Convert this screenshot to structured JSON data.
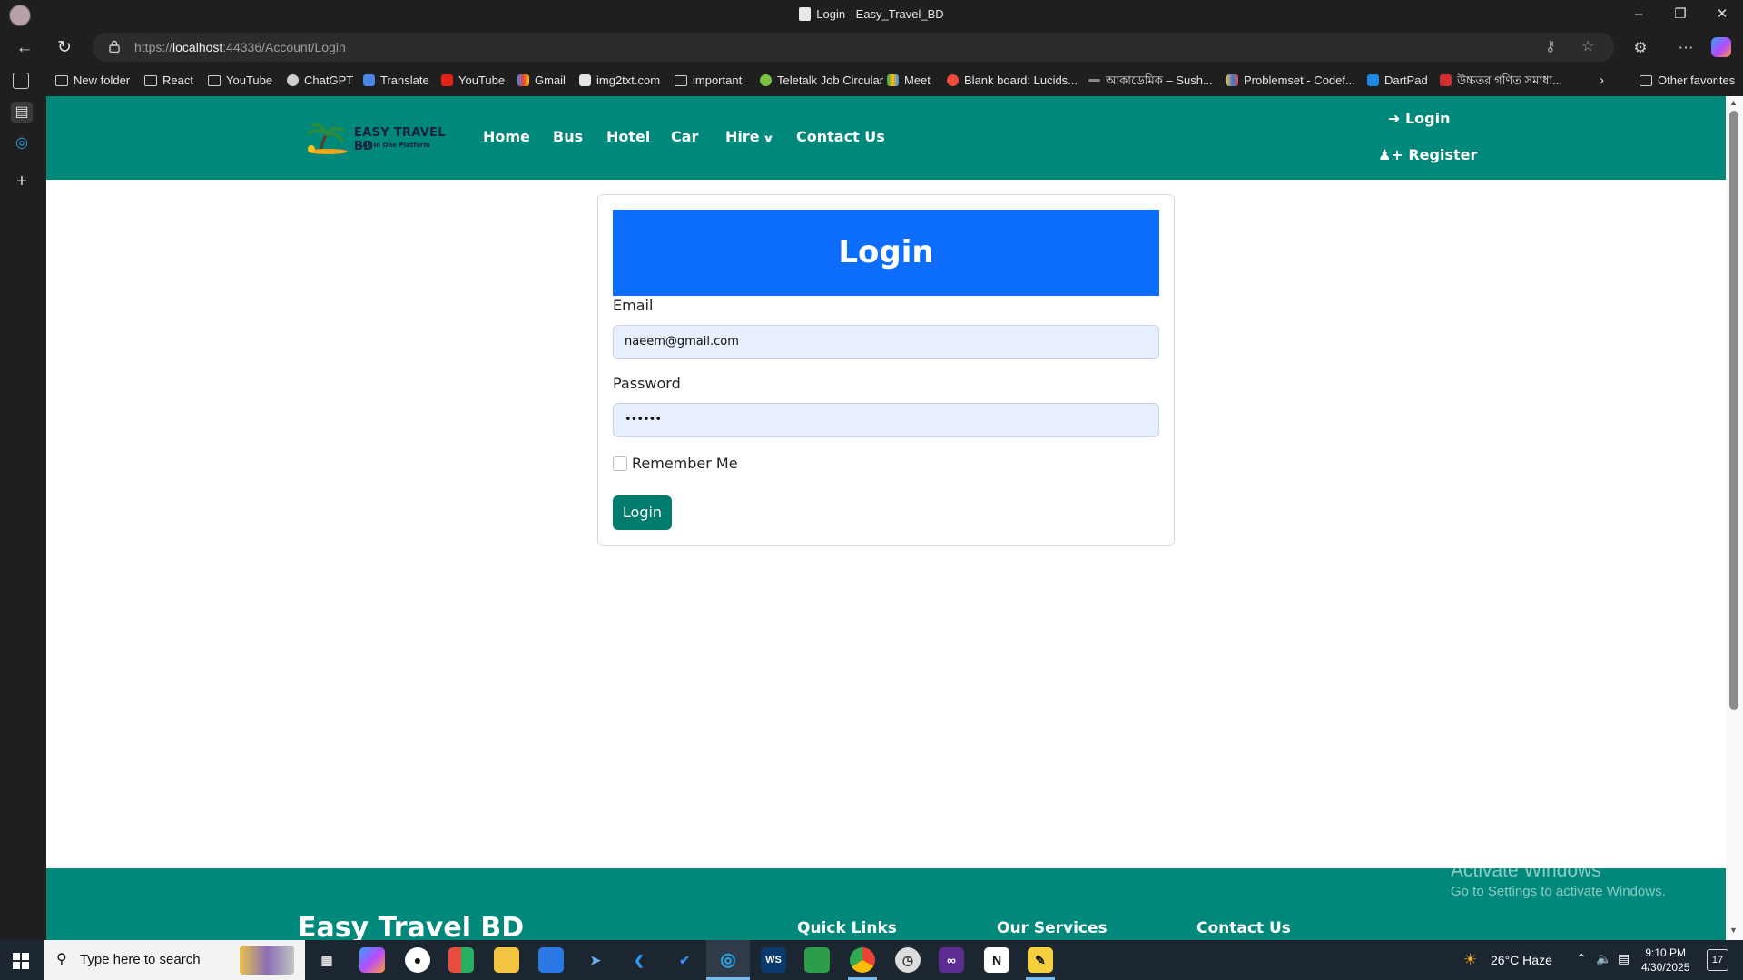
{
  "browser": {
    "window_title": "Login - Easy_Travel_BD",
    "url_scheme": "https://",
    "url_host": "localhost",
    "url_rest": ":44336/Account/Login",
    "bookmarks": [
      {
        "label": "New folder",
        "icon": "folder-icon"
      },
      {
        "label": "React",
        "icon": "folder-icon"
      },
      {
        "label": "YouTube",
        "icon": "folder-icon"
      },
      {
        "label": "ChatGPT",
        "icon": "chatgpt-icon"
      },
      {
        "label": "Translate",
        "icon": "translate-icon"
      },
      {
        "label": "YouTube",
        "icon": "youtube-icon"
      },
      {
        "label": "Gmail",
        "icon": "gmail-icon"
      },
      {
        "label": "img2txt.com",
        "icon": "page-icon"
      },
      {
        "label": "important",
        "icon": "folder-icon"
      },
      {
        "label": "Teletalk Job Circular",
        "icon": "teletalk-icon"
      },
      {
        "label": "Meet",
        "icon": "meet-icon"
      },
      {
        "label": "Blank board: Lucids...",
        "icon": "lucid-icon"
      },
      {
        "label": "আকাডেমিক – Sush...",
        "icon": "page-icon"
      },
      {
        "label": "Problemset - Codef...",
        "icon": "codeforces-icon"
      },
      {
        "label": "DartPad",
        "icon": "dart-icon"
      },
      {
        "label": "উচ্চতর গণিত সমাধা...",
        "icon": "book-icon"
      }
    ],
    "other_favorites": "Other favorites"
  },
  "site": {
    "logo_title": "EASY TRAVEL BD",
    "logo_tagline": "All in One Platform",
    "nav": [
      "Home",
      "Bus",
      "Hotel",
      "Car",
      "Hire",
      "Contact Us"
    ],
    "auth": {
      "login": "Login",
      "register": "Register"
    }
  },
  "form": {
    "heading": "Login",
    "email_label": "Email",
    "email_value": "naeem@gmail.com",
    "password_label": "Password",
    "password_mask": "••••••",
    "remember_label": "Remember Me",
    "submit_label": "Login"
  },
  "footer": {
    "brand": "Easy Travel BD",
    "col1": "Quick Links",
    "col2": "Our Services",
    "col3": "Contact Us"
  },
  "watermark": {
    "line1": "Activate Windows",
    "line2": "Go to Settings to activate Windows."
  },
  "taskbar": {
    "search_placeholder": "Type here to search",
    "weather": "26°C  Haze",
    "time": "9:10 PM",
    "date": "4/30/2025",
    "notifications": "17"
  },
  "colors": {
    "nav_bg": "#00887a",
    "card_header": "#0d6efd",
    "button": "#007c6d"
  }
}
